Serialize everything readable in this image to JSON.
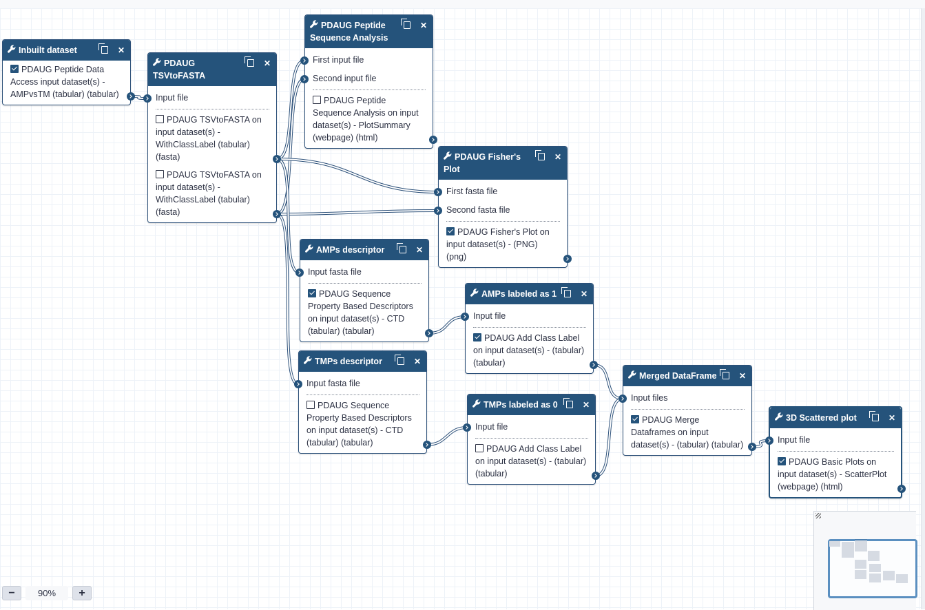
{
  "canvas": {
    "zoom_level": "90%",
    "zoom_out_label": "−",
    "zoom_in_label": "+"
  },
  "colors": {
    "node_header": "#25537b",
    "node_border": "#2c5079",
    "wire": "#2c5079",
    "grid": "#edf2f8"
  },
  "nodes": [
    {
      "id": "inbuilt",
      "title": "Inbuilt dataset",
      "inputs": [],
      "outputs": [
        {
          "checked": true,
          "label": "PDAUG Peptide Data Access input dataset(s) - AMPvsTM (tabular) (tabular)"
        }
      ]
    },
    {
      "id": "tsvtofasta",
      "title": "PDAUG TSVtoFASTA",
      "inputs": [
        "Input file"
      ],
      "outputs": [
        {
          "checked": false,
          "label": "PDAUG TSVtoFASTA on input dataset(s) - WithClassLabel (tabular) (fasta)"
        },
        {
          "checked": false,
          "label": "PDAUG TSVtoFASTA on input dataset(s) - WithClassLabel (tabular) (fasta)"
        }
      ]
    },
    {
      "id": "seqanalysis",
      "title": "PDAUG Peptide Sequence Analysis",
      "inputs": [
        "First input file",
        "Second input file"
      ],
      "outputs": [
        {
          "checked": false,
          "label": "PDAUG Peptide Sequence Analysis on input dataset(s) - PlotSummary (webpage) (html)"
        }
      ]
    },
    {
      "id": "fisher",
      "title": "PDAUG Fisher's Plot",
      "inputs": [
        "First fasta file",
        "Second fasta file"
      ],
      "outputs": [
        {
          "checked": true,
          "label": "PDAUG Fisher's Plot on input dataset(s) - (PNG) (png)"
        }
      ]
    },
    {
      "id": "ampsdesc",
      "title": "AMPs descriptor",
      "inputs": [
        "Input fasta file"
      ],
      "outputs": [
        {
          "checked": true,
          "label": "PDAUG Sequence Property Based Descriptors on input dataset(s) - CTD (tabular) (tabular)"
        }
      ]
    },
    {
      "id": "ampslabel",
      "title": "AMPs labeled as 1",
      "inputs": [
        "Input file"
      ],
      "outputs": [
        {
          "checked": true,
          "label": "PDAUG Add Class Label on input dataset(s) - (tabular) (tabular)"
        }
      ]
    },
    {
      "id": "tmpsdesc",
      "title": "TMPs descriptor",
      "inputs": [
        "Input fasta file"
      ],
      "outputs": [
        {
          "checked": false,
          "label": "PDAUG Sequence Property Based Descriptors on input dataset(s) - CTD (tabular) (tabular)"
        }
      ]
    },
    {
      "id": "tmpslabel",
      "title": "TMPs labeled as 0",
      "inputs": [
        "Input file"
      ],
      "outputs": [
        {
          "checked": false,
          "label": "PDAUG Add Class Label on input dataset(s) - (tabular) (tabular)"
        }
      ]
    },
    {
      "id": "merged",
      "title": "Merged DataFrame",
      "inputs": [
        "Input files"
      ],
      "outputs": [
        {
          "checked": true,
          "label": "PDAUG Merge Dataframes on input dataset(s) - (tabular) (tabular)"
        }
      ]
    },
    {
      "id": "scatter",
      "title": "3D Scattered plot",
      "selected": true,
      "inputs": [
        "Input file"
      ],
      "outputs": [
        {
          "checked": true,
          "label": "PDAUG Basic Plots on input dataset(s) - ScatterPlot (webpage) (html)"
        }
      ]
    }
  ],
  "connections": [
    {
      "from": "inbuilt.0",
      "to": "tsvtofasta.0"
    },
    {
      "from": "tsvtofasta.0",
      "to": "seqanalysis.0"
    },
    {
      "from": "tsvtofasta.1",
      "to": "seqanalysis.1"
    },
    {
      "from": "tsvtofasta.0",
      "to": "fisher.0"
    },
    {
      "from": "tsvtofasta.1",
      "to": "fisher.1"
    },
    {
      "from": "tsvtofasta.0",
      "to": "ampsdesc.0"
    },
    {
      "from": "tsvtofasta.1",
      "to": "tmpsdesc.0"
    },
    {
      "from": "ampsdesc.0",
      "to": "ampslabel.0"
    },
    {
      "from": "tmpsdesc.0",
      "to": "tmpslabel.0"
    },
    {
      "from": "ampslabel.0",
      "to": "merged.0"
    },
    {
      "from": "tmpslabel.0",
      "to": "merged.0"
    },
    {
      "from": "merged.0",
      "to": "scatter.0"
    }
  ]
}
